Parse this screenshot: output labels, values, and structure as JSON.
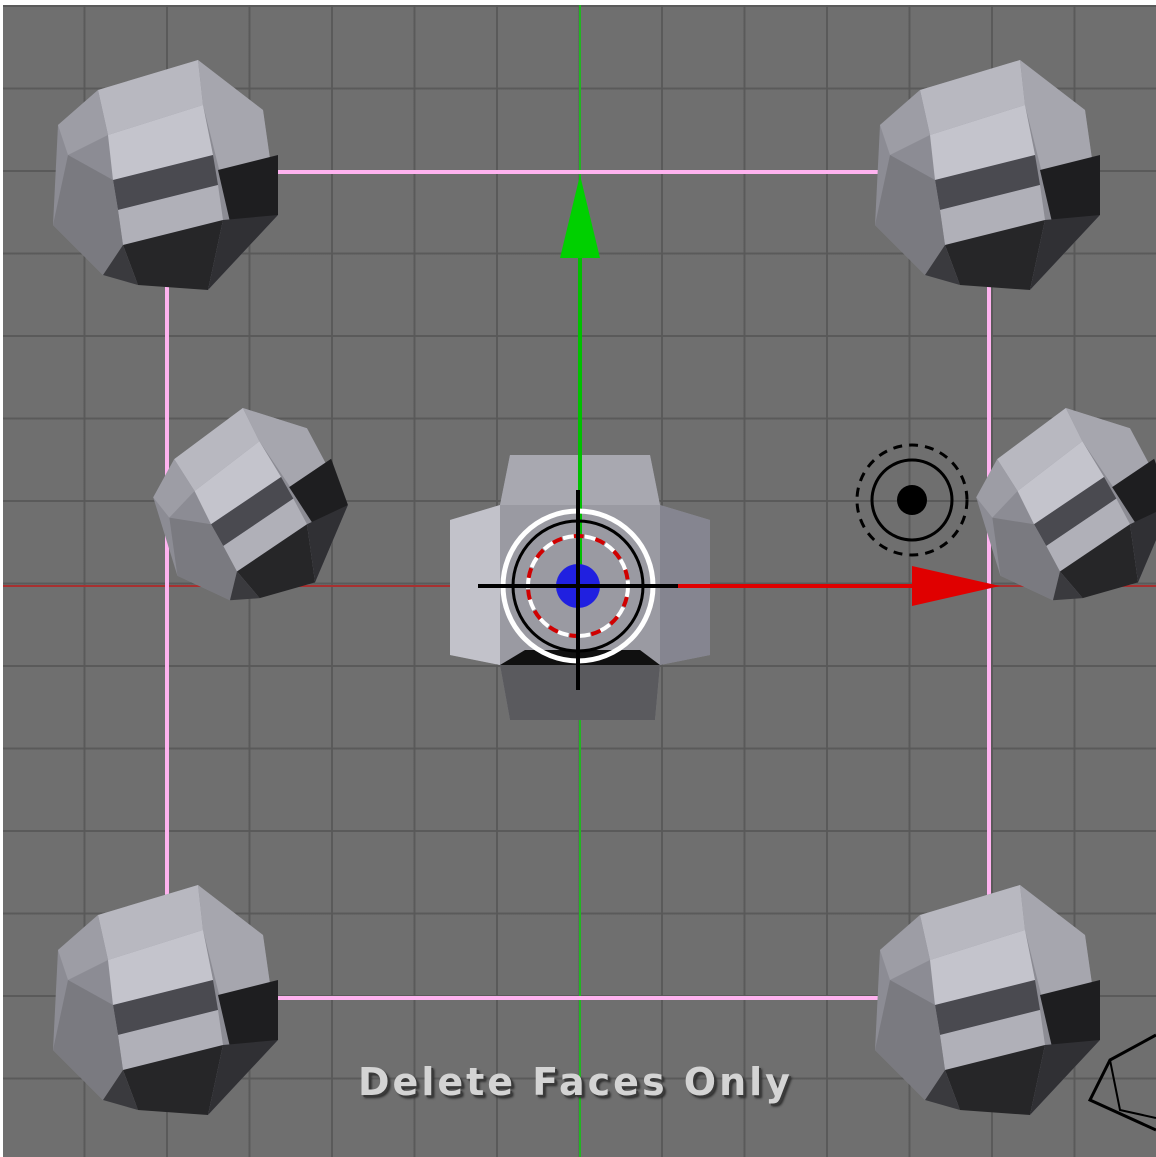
{
  "viewport": {
    "grid_color": "#5a5a5a",
    "background_color": "#6f6f6f",
    "status_text": "Delete Faces Only"
  },
  "axes": {
    "x_axis_color": "#cc0000",
    "y_axis_color": "#00cc00",
    "z_handle_color": "#2020e0"
  },
  "selection": {
    "outline_color": "#ffb3f0"
  },
  "objects": [
    {
      "name": "rounded-cube-top-left"
    },
    {
      "name": "rounded-cube-top-right"
    },
    {
      "name": "rounded-cube-middle-left"
    },
    {
      "name": "rounded-cube-center"
    },
    {
      "name": "rounded-cube-middle-right"
    },
    {
      "name": "rounded-cube-bottom-left"
    },
    {
      "name": "rounded-cube-bottom-right"
    }
  ],
  "icons": [
    "3d-cursor-icon",
    "lamp-icon",
    "camera-icon",
    "transform-manipulator-icon"
  ]
}
